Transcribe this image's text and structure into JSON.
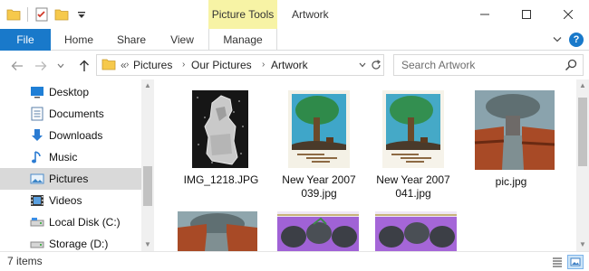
{
  "window": {
    "title": "Artwork",
    "context_tab_header": "Picture Tools",
    "controls": {
      "minimize": "minimize-icon",
      "maximize": "maximize-icon",
      "close": "close-icon"
    }
  },
  "ribbon": {
    "tabs": [
      {
        "label": "File"
      },
      {
        "label": "Home"
      },
      {
        "label": "Share"
      },
      {
        "label": "View"
      },
      {
        "label": "Manage"
      }
    ]
  },
  "address_bar": {
    "overflow": "«",
    "segments": [
      "Pictures",
      "Our Pictures",
      "Artwork"
    ]
  },
  "search": {
    "placeholder": "Search Artwork"
  },
  "nav_pane": {
    "items": [
      {
        "label": "Desktop",
        "icon": "desktop-icon"
      },
      {
        "label": "Documents",
        "icon": "documents-icon"
      },
      {
        "label": "Downloads",
        "icon": "downloads-icon"
      },
      {
        "label": "Music",
        "icon": "music-icon"
      },
      {
        "label": "Pictures",
        "icon": "pictures-icon",
        "selected": true
      },
      {
        "label": "Videos",
        "icon": "videos-icon"
      },
      {
        "label": "Local Disk (C:)",
        "icon": "drive-icon"
      },
      {
        "label": "Storage (D:)",
        "icon": "drive-icon"
      }
    ]
  },
  "files": [
    {
      "name": "IMG_1218.JPG"
    },
    {
      "name": "New Year 2007\n039.jpg"
    },
    {
      "name": "New Year 2007\n041.jpg"
    },
    {
      "name": "pic.jpg"
    },
    {
      "name": ""
    },
    {
      "name": ""
    },
    {
      "name": ""
    }
  ],
  "status": {
    "item_count": "7 items"
  },
  "colors": {
    "accent": "#1979ca",
    "context_tab": "#f7f3a5",
    "selection": "#d9d9d9"
  }
}
